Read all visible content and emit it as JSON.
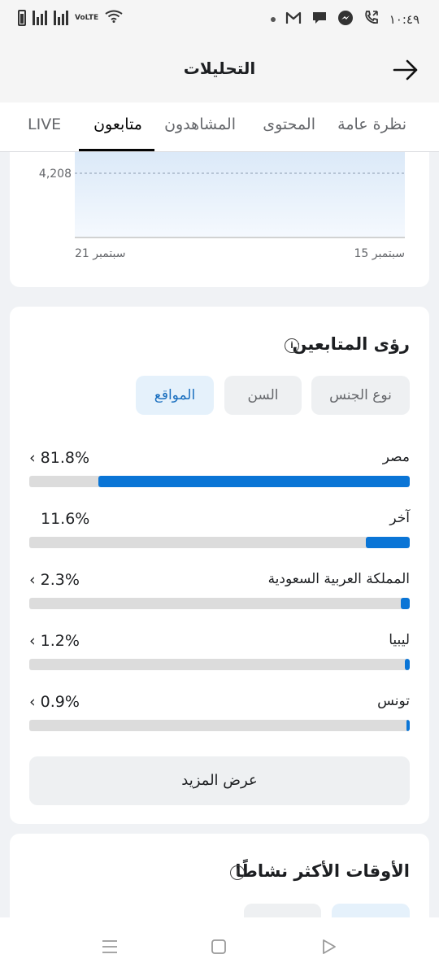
{
  "status_bar": {
    "time": "١٠:٤٩",
    "network_label": "VoLTE",
    "icons": [
      "battery-icon",
      "signal-icon",
      "wifi-icon",
      "dot-icon",
      "gmail-icon",
      "chat-icon",
      "messenger-icon",
      "call-icon"
    ]
  },
  "header": {
    "title": "التحليلات"
  },
  "tabs": [
    {
      "label": "نظرة عامة"
    },
    {
      "label": "المحتوى"
    },
    {
      "label": "المشاهدون"
    },
    {
      "label": "متابعون"
    },
    {
      "label": "LIVE"
    }
  ],
  "active_tab": "متابعون",
  "chart_data": {
    "type": "area",
    "x_ticks": [
      "سبتمبر 15",
      "سبتمبر 21"
    ],
    "y_ticks": [
      "4,208"
    ],
    "accent_color": "#0a75d6"
  },
  "followers_insights": {
    "title": "رؤى المتابعين",
    "filters": [
      {
        "label": "نوع الجنس"
      },
      {
        "label": "السن"
      },
      {
        "label": "المواقع"
      }
    ],
    "active_filter": "المواقع",
    "locations": [
      {
        "name": "مصر",
        "value": "81.8%",
        "fraction": 0.818,
        "has_chevron": true
      },
      {
        "name": "آخر",
        "value": "11.6%",
        "fraction": 0.116,
        "has_chevron": false
      },
      {
        "name": "المملكة العربية السعودية",
        "value": "2.3%",
        "fraction": 0.023,
        "has_chevron": true
      },
      {
        "name": "ليبيا",
        "value": "1.2%",
        "fraction": 0.012,
        "has_chevron": true
      },
      {
        "name": "تونس",
        "value": "0.9%",
        "fraction": 0.009,
        "has_chevron": true
      }
    ],
    "more_label": "عرض المزيد"
  },
  "active_times": {
    "title": "الأوقات الأكثر نشاطًا"
  },
  "colors": {
    "accent": "#0a75d6",
    "track": "#dcdcdc",
    "active_filter_bg": "#e5f1fb"
  }
}
